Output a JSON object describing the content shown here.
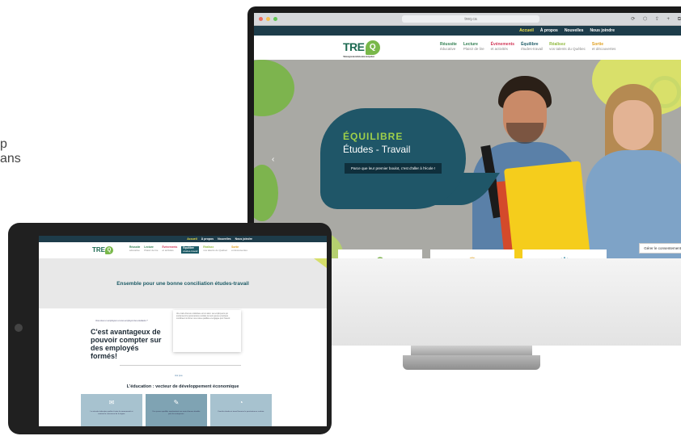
{
  "side_text": {
    "line1": "p",
    "line2": "ans"
  },
  "desktop": {
    "url": "treq.ca",
    "browser_icons": "⟳ ⬡ ⇪ + ⧉",
    "topnav": [
      "Accueil",
      "À propos",
      "Nouvelles",
      "Nous joindre"
    ],
    "logo": {
      "text": "TRE",
      "bubble": "Q",
      "subtitle": "Table régionale de l'éducation de Québec"
    },
    "menu": [
      {
        "title": "Réussite",
        "sub": "éducative",
        "color": "#2e7d4f"
      },
      {
        "title": "Lecture",
        "sub": "Plaisir de lire",
        "color": "#2e7d4f"
      },
      {
        "title": "Événements",
        "sub": "et activités",
        "color": "#d23a5a"
      },
      {
        "title": "Équilibre",
        "sub": "études-travail",
        "color": "#1d5b66"
      },
      {
        "title": "Réalisez",
        "sub": "vos talents du Québec",
        "color": "#8fb93d"
      },
      {
        "title": "Sortie",
        "sub": "et découvertes",
        "color": "#e0a020"
      }
    ],
    "hero": {
      "title": "ÉQUILIBRE",
      "subtitle": "Études - Travail",
      "button": "Parce que leur premier boulot, c'est d'aller à l'école !",
      "arrow_left": "‹",
      "arrow_right": "›"
    },
    "cards": [
      "⚲",
      "✺",
      "❋"
    ],
    "consent": "Gérer le consentement"
  },
  "tablet": {
    "topnav": [
      "Accueil",
      "À propos",
      "Nouvelles",
      "Nous joindre"
    ],
    "logo": {
      "text": "TRE",
      "bubble": "Q"
    },
    "menu": [
      {
        "title": "Réussite",
        "sub": "éducative",
        "color": "#2e7d4f"
      },
      {
        "title": "Lecture",
        "sub": "Plaisir de lire",
        "color": "#2e7d4f"
      },
      {
        "title": "Événements",
        "sub": "et activités",
        "color": "#d23a5a"
      },
      {
        "title": "Équilibre",
        "sub": "études-travail",
        "color": "#ffffff"
      },
      {
        "title": "Réalisez",
        "sub": "vos talents du Québec",
        "color": "#8fb93d"
      },
      {
        "title": "Sortie",
        "sub": "et découvertes",
        "color": "#e0a020"
      }
    ],
    "band_title": "Ensemble pour une bonne conciliation études-travail",
    "small_heading": "Vous êtes un employeur et vous employez des étudiants ?",
    "big_heading": "C'est avantageux de pouvoir compter sur des employés formés!",
    "box_text": "Une main-d'œuvre scolarisée est un atout. Les employeurs qui soutiennent la persévérance scolaire de leurs jeunes employés contribuent à former une relève qualifiée et engagée pour l'avenir.",
    "link": "Voir plus",
    "section_title": "L'éducation : vecteur de développement économique",
    "cards": [
      {
        "icon": "✉",
        "bg": "#a7c2cf",
        "text": "La réussite éducative profite à toute la communauté et soutient la croissance de la région."
      },
      {
        "icon": "✎",
        "bg": "#7fa3b3",
        "text": "Des jeunes qualifiés représentent une main-d'œuvre durable pour les entreprises."
      },
      {
        "icon": "◔",
        "bg": "#a7c2cf",
        "text": "Concilier études et travail favorise la persévérance scolaire."
      }
    ]
  }
}
